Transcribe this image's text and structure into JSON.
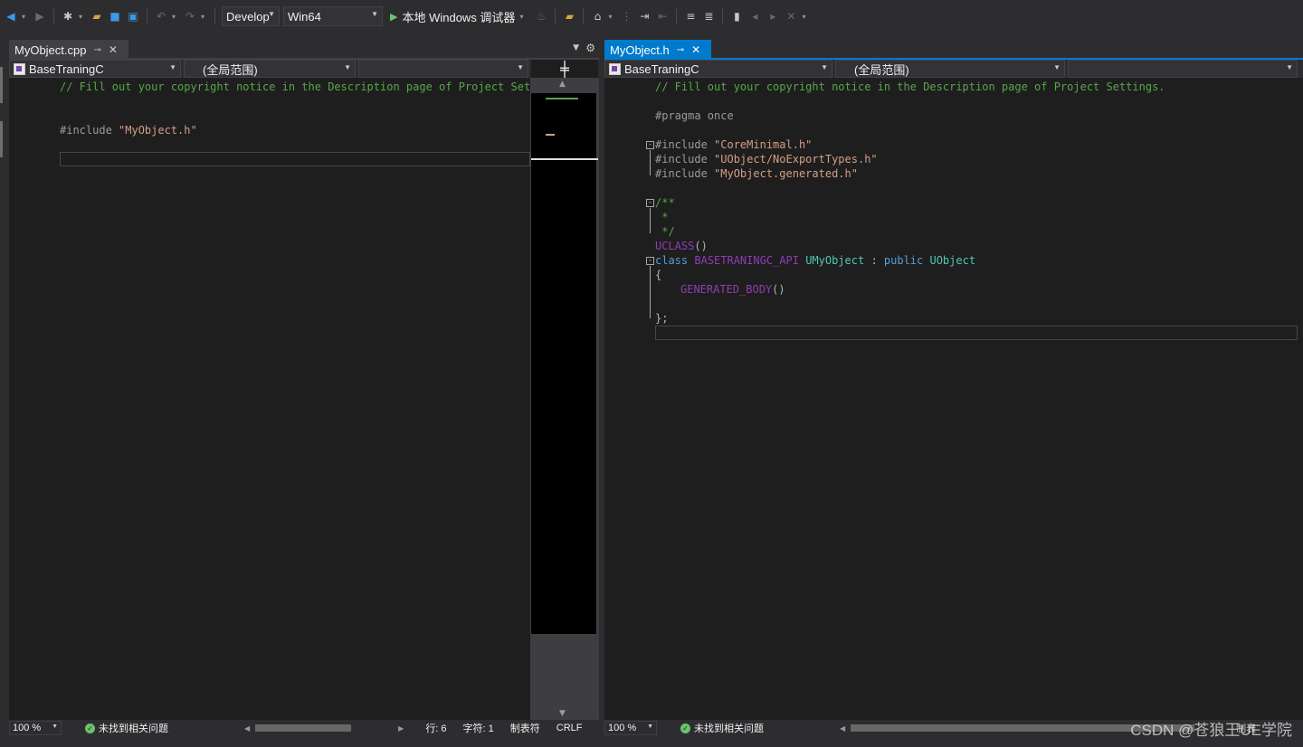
{
  "toolbar": {
    "config_combo": "Develop",
    "platform_combo": "Win64",
    "run_label": "本地 Windows 调试器"
  },
  "left_pane": {
    "tab_label": "MyObject.cpp",
    "nav_project": "BaseTraningC",
    "nav_scope": "(全局范围)",
    "lines": {
      "l1": "// Fill out your copyright notice in the Description page of Project Settings.",
      "l3_pre": "#include ",
      "l3_str": "\"MyObject.h\""
    },
    "status": {
      "zoom": "100 %",
      "issues": "未找到相关问题",
      "line": "行: 6",
      "col": "字符: 1",
      "tabs": "制表符",
      "eol": "CRLF"
    }
  },
  "right_pane": {
    "tab_label": "MyObject.h",
    "nav_project": "BaseTraningC",
    "nav_scope": "(全局范围)",
    "lines": {
      "l1": "// Fill out your copyright notice in the Description page of Project Settings.",
      "l3": "#pragma once",
      "inc_kw": "#include ",
      "inc1": "\"CoreMinimal.h\"",
      "inc2": "\"UObject/NoExportTypes.h\"",
      "inc3": "\"MyObject.generated.h\"",
      "c1": "/**",
      "c2": " *",
      "c3": " */",
      "uclass": "UCLASS",
      "uclass_paren": "()",
      "kw_class": "class ",
      "api": "BASETRANINGC_API ",
      "type_name": "UMyObject",
      "colon": " : ",
      "kw_public": "public ",
      "base": "UObject",
      "brace_open": "{",
      "gen_body": "GENERATED_BODY",
      "gen_paren": "()",
      "brace_close": "};"
    },
    "status": {
      "zoom": "100 %",
      "issues": "未找到相关问题",
      "tabs_partial": "制表"
    }
  },
  "watermark": "CSDN @苍狼王UE学院",
  "icons": [
    "back-icon",
    "forward-icon",
    "new-project-icon",
    "open-folder-icon",
    "save-icon",
    "save-all-icon",
    "undo-icon",
    "redo-icon",
    "play-icon",
    "find-in-files-icon",
    "bookmark-icon",
    "settings-icon",
    "pin-icon",
    "close-icon",
    "split-icon"
  ]
}
